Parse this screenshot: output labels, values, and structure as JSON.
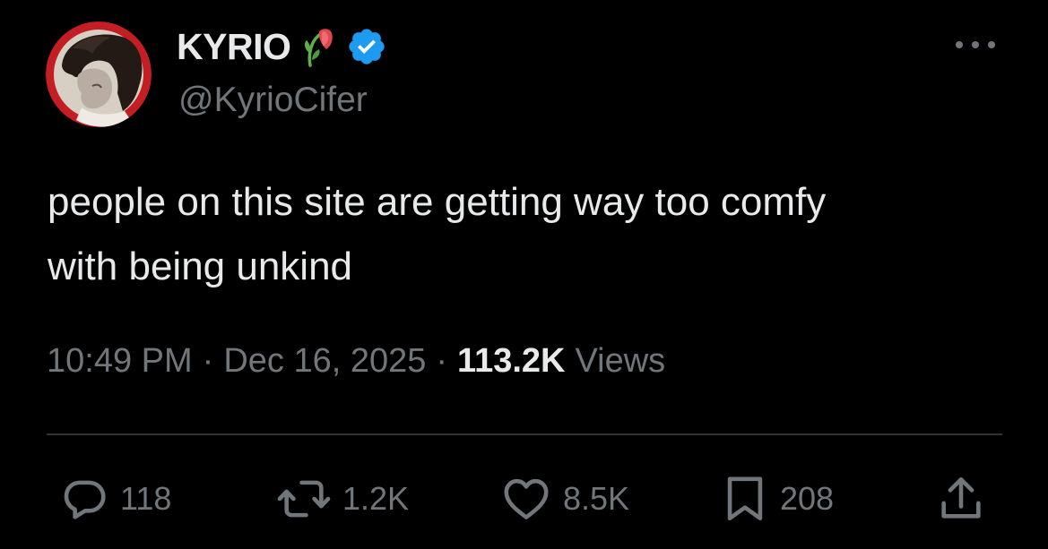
{
  "author": {
    "display_name": "KYRIO",
    "handle": "@KyrioCifer",
    "verified": true,
    "name_emoji": "wilted-flower-emoji",
    "avatar": "profile-photo"
  },
  "tweet": {
    "text_line1": "people on this site are getting way too comfy",
    "text_line2": "with being unkind",
    "time": "10:49 PM",
    "separator": "·",
    "date": "Dec 16, 2025",
    "views_count": "113.2K",
    "views_label": "Views"
  },
  "actions": {
    "replies": "118",
    "reposts": "1.2K",
    "likes": "8.5K",
    "bookmarks": "208"
  },
  "icons": {
    "more": "more-horizontal-icon",
    "reply": "reply-icon",
    "repost": "repost-icon",
    "like": "heart-icon",
    "bookmark": "bookmark-icon",
    "share": "share-icon",
    "verified": "verified-badge-icon"
  },
  "colors": {
    "background": "#000000",
    "text_primary": "#e7e9ea",
    "text_secondary": "#71767b",
    "verified_blue": "#1d9bf0",
    "divider": "#2f3336",
    "avatar_ring": "#c41e25"
  }
}
